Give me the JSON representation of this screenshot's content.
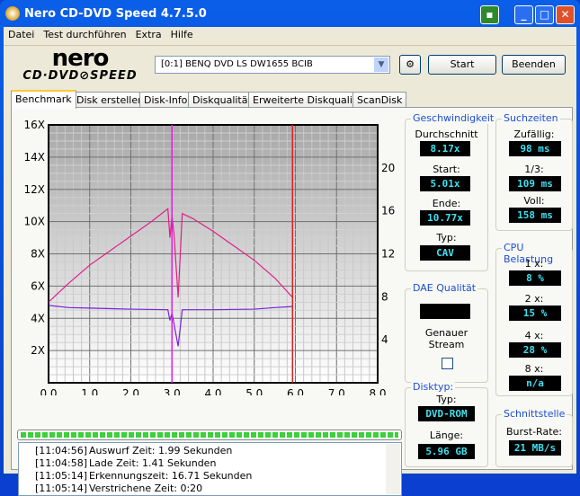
{
  "window": {
    "title": "Nero CD-DVD Speed 4.7.5.0"
  },
  "menu": [
    "Datei",
    "Test durchführen",
    "Extra",
    "Hilfe"
  ],
  "logo": {
    "top": "nero",
    "bottom": "CD·DVD SPEED"
  },
  "toolbar": {
    "drive": "[0:1]  BENQ DVD LS DW1655 BCIB",
    "start": "Start",
    "exit": "Beenden"
  },
  "tabs": [
    "Benchmark",
    "Disk erstellen",
    "Disk-Info",
    "Diskqualität",
    "Erweiterte Diskqualität",
    "ScanDisk"
  ],
  "speed": {
    "title": "Geschwindigkeit",
    "avg_label": "Durchschnitt",
    "avg": "8.17x",
    "start_label": "Start:",
    "start": "5.01x",
    "end_label": "Ende:",
    "end": "10.77x",
    "type_label": "Typ:",
    "type": "CAV"
  },
  "seek": {
    "title": "Suchzeiten",
    "random_label": "Zufällig:",
    "random": "98 ms",
    "third_label": "1/3:",
    "third": "109 ms",
    "full_label": "Voll:",
    "full": "158 ms"
  },
  "dae": {
    "title": "DAE Qualität",
    "value": "",
    "stream_label": "Genauer Stream",
    "stream_checked": false
  },
  "cpu": {
    "title": "CPU Belastung",
    "l1": "1 x:",
    "v1": "8 %",
    "l2": "2 x:",
    "v2": "15 %",
    "l4": "4 x:",
    "v4": "28 %",
    "l8": "8 x:",
    "v8": "n/a"
  },
  "disk": {
    "title": "Disktyp:",
    "type_label": "Typ:",
    "type": "DVD-ROM",
    "length_label": "Länge:",
    "length": "5.96 GB"
  },
  "iface": {
    "title": "Schnittstelle",
    "burst_label": "Burst-Rate:",
    "burst": "21 MB/s"
  },
  "progress": 100,
  "log": [
    {
      "time": "[11:04:56]",
      "text": "Auswurf Zeit: 1.99 Sekunden"
    },
    {
      "time": "[11:04:58]",
      "text": "Lade Zeit: 1.41 Sekunden"
    },
    {
      "time": "[11:05:14]",
      "text": "Erkennungszeit: 16.71 Sekunden"
    },
    {
      "time": "[11:05:14]",
      "text": "Verstrichene Zeit:  0:20"
    }
  ],
  "chart_data": {
    "type": "line",
    "xlim": [
      0,
      8
    ],
    "ylim": [
      0,
      16
    ],
    "y2lim": [
      0,
      24
    ],
    "xticks": [
      "0.0",
      "1.0",
      "2.0",
      "3.0",
      "4.0",
      "5.0",
      "6.0",
      "7.0",
      "8.0"
    ],
    "yticks": [
      "2X",
      "4X",
      "6X",
      "8X",
      "10X",
      "12X",
      "14X",
      "16X"
    ],
    "y2ticks": [
      "4",
      "8",
      "12",
      "16",
      "20"
    ],
    "grid": true,
    "colors": {
      "speed": "#e0208a",
      "seek": "#7a20e0",
      "marker1": "#e020e0",
      "marker2": "#e02020"
    },
    "speed": [
      [
        0,
        5.01
      ],
      [
        0.5,
        6.2
      ],
      [
        1,
        7.3
      ],
      [
        1.5,
        8.2
      ],
      [
        2,
        9.1
      ],
      [
        2.5,
        10
      ],
      [
        2.9,
        10.8
      ],
      [
        2.95,
        9
      ],
      [
        3.0,
        10.4
      ],
      [
        3.05,
        9.2
      ],
      [
        3.15,
        5.3
      ],
      [
        3.25,
        10.5
      ],
      [
        3.5,
        10.2
      ],
      [
        4,
        9.4
      ],
      [
        4.5,
        8.5
      ],
      [
        5,
        7.6
      ],
      [
        5.5,
        6.5
      ],
      [
        5.93,
        5.3
      ]
    ],
    "seek_axis2": [
      [
        0,
        7.2
      ],
      [
        0.5,
        7.0
      ],
      [
        1,
        6.95
      ],
      [
        2,
        6.85
      ],
      [
        2.9,
        6.8
      ],
      [
        2.95,
        5.8
      ],
      [
        3.0,
        6.5
      ],
      [
        3.15,
        3.4
      ],
      [
        3.25,
        6.8
      ],
      [
        4,
        6.8
      ],
      [
        5,
        6.85
      ],
      [
        5.5,
        7.0
      ],
      [
        5.93,
        7.1
      ]
    ],
    "markers_x": [
      3.0,
      5.93
    ]
  }
}
